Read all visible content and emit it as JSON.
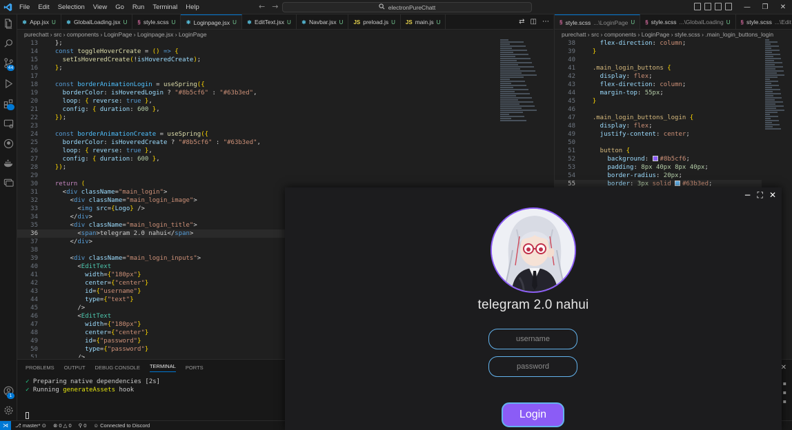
{
  "titlebar": {
    "menu": [
      "File",
      "Edit",
      "Selection",
      "View",
      "Go",
      "Run",
      "Terminal",
      "Help"
    ],
    "search_text": "electronPureChatt"
  },
  "activity_badge": "44",
  "left_editor": {
    "tabs": [
      {
        "name": "App.jsx",
        "icon": "react-icon",
        "status": "U"
      },
      {
        "name": "GlobalLoading.jsx",
        "icon": "react-icon",
        "status": "U"
      },
      {
        "name": "style.scss",
        "icon": "sass-icon",
        "status": "U"
      },
      {
        "name": "Loginpage.jsx",
        "icon": "react-icon",
        "status": "U"
      },
      {
        "name": "EditText.jsx",
        "icon": "react-icon",
        "status": "U"
      },
      {
        "name": "Navbar.jsx",
        "icon": "react-icon",
        "status": "U"
      },
      {
        "name": "preload.js",
        "icon": "js-icon",
        "status": "U"
      },
      {
        "name": "main.js",
        "icon": "js-icon",
        "status": "U"
      }
    ],
    "active_tab": 3,
    "breadcrumb": "purechatt › src › components › LoginPage › Loginpage.jsx › LoginPage",
    "current_line": 36
  },
  "right_editor": {
    "tabs": [
      {
        "name": "style.scss",
        "detail": "...\\LoginPage",
        "icon": "sass-icon",
        "status": "U"
      },
      {
        "name": "style.scss",
        "detail": "...\\GlobalLoading",
        "icon": "sass-icon",
        "status": "U"
      },
      {
        "name": "style.scss",
        "detail": "...\\Edit",
        "icon": "sass-icon",
        "status": ""
      }
    ],
    "breadcrumb": "purechatt › src › components › LoginPage › style.scss › .main_login_buttons_login",
    "current_line": 55
  },
  "panel": {
    "tabs": [
      "PROBLEMS",
      "OUTPUT",
      "DEBUG CONSOLE",
      "TERMINAL",
      "PORTS"
    ],
    "active_tab": 3,
    "lines": [
      {
        "check": "✓",
        "text": "Preparing native dependencies [2s]",
        "highlight": ""
      },
      {
        "check": "✓",
        "text": "Running ",
        "highlight": "generateAssets",
        "suffix": " hook"
      }
    ]
  },
  "statusbar": {
    "branch": "master*",
    "errors": "0",
    "warnings": "0",
    "ports": "0",
    "discord": "Connected to Discord"
  },
  "app": {
    "title": "telegram 2.0 nahui",
    "username_placeholder": "username",
    "password_placeholder": "password",
    "login_label": "Login",
    "accent": "#8b5cf6",
    "border": "#63b3ed"
  },
  "colors": {
    "accent_blue": "#0078d4",
    "git_untracked": "#73c991",
    "swatch_purple": "#8b5cf6",
    "swatch_blue": "#63b3ed"
  }
}
